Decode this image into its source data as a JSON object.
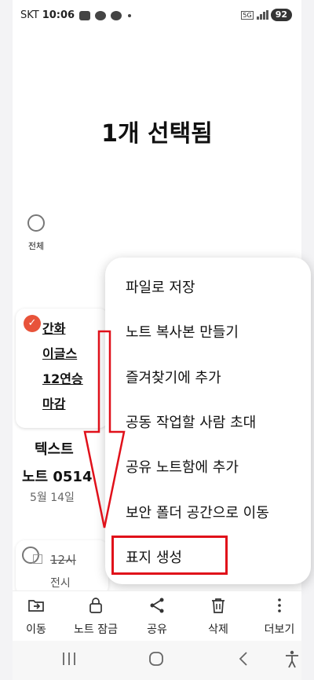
{
  "status_bar": {
    "carrier": "SKT",
    "time": "10:06",
    "network": "5G",
    "battery": "92"
  },
  "header": {
    "title": "1개 선택됨"
  },
  "select_all": {
    "label": "전체"
  },
  "notes": {
    "selected_card_lines": [
      "간화",
      "이글스",
      "12연승",
      "마감"
    ],
    "text_note_title_1": "텍스트",
    "text_note_title_2": "노트 0514",
    "text_note_date": "5월 14일",
    "card2_line1": "12시",
    "card2_line2": "전시"
  },
  "menu": {
    "items": [
      "파일로 저장",
      "노트 복사본 만들기",
      "즐겨찾기에 추가",
      "공동 작업할 사람 초대",
      "공유 노트함에 추가",
      "보안 폴더 공간으로 이동",
      "표지 생성"
    ]
  },
  "toolbar": {
    "move": "이동",
    "lock": "노트 잠금",
    "share": "공유",
    "delete": "삭제",
    "more": "더보기"
  },
  "colors": {
    "accent_check": "#e8533a",
    "annotation_red": "#e0101a"
  }
}
